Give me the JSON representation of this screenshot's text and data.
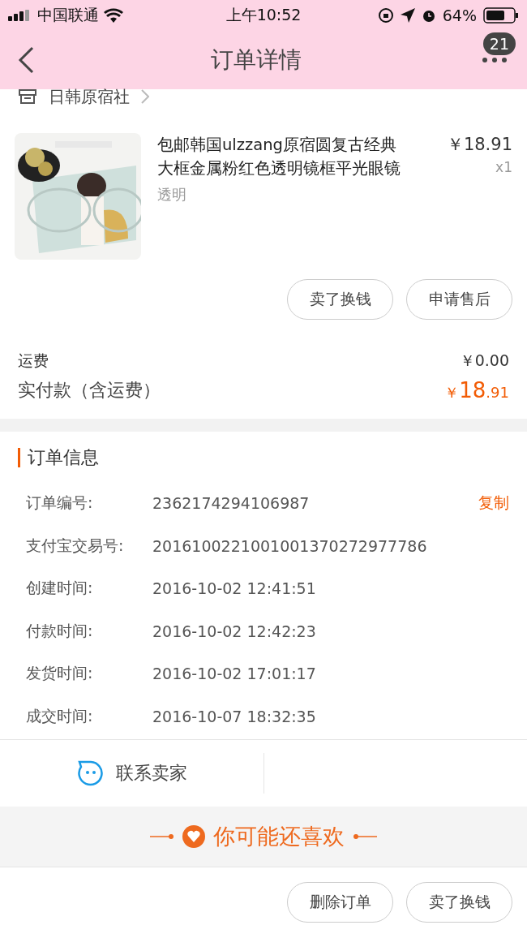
{
  "status_bar": {
    "carrier": "中国联通",
    "time": "上午10:52",
    "battery": "64%"
  },
  "nav": {
    "title": "订单详情",
    "badge": "21"
  },
  "shop": {
    "name": "日韩原宿社"
  },
  "product": {
    "kind": "picture",
    "title": "包邮韩国ulzzang原宿圆复古经典大框金属粉红色透明镜框平光眼镜",
    "variant": "透明",
    "price": "￥18.91",
    "quantity": "x1"
  },
  "item_actions": [
    "卖了换钱",
    "申请售后"
  ],
  "fees": {
    "shipping_label": "运费",
    "shipping_value": "￥0.00",
    "paid_label": "实付款（含运费）",
    "paid_currency": "￥",
    "paid_integer": "18",
    "paid_decimal": ".91"
  },
  "order_info": {
    "title": "订单信息",
    "copy": "复制",
    "rows": [
      {
        "label": "订单编号:",
        "value": "2362174294106987"
      },
      {
        "label": "支付宝交易号:",
        "value": "2016100221001001370272977786"
      },
      {
        "label": "创建时间:",
        "value": "2016-10-02 12:41:51"
      },
      {
        "label": "付款时间:",
        "value": "2016-10-02 12:42:23"
      },
      {
        "label": "发货时间:",
        "value": "2016-10-02 17:01:17"
      },
      {
        "label": "成交时间:",
        "value": "2016-10-07 18:32:35"
      }
    ]
  },
  "contact": {
    "label": "联系卖家"
  },
  "recommend": {
    "title": "你可能还喜欢"
  },
  "bottom_actions": [
    "删除订单",
    "卖了换钱"
  ]
}
